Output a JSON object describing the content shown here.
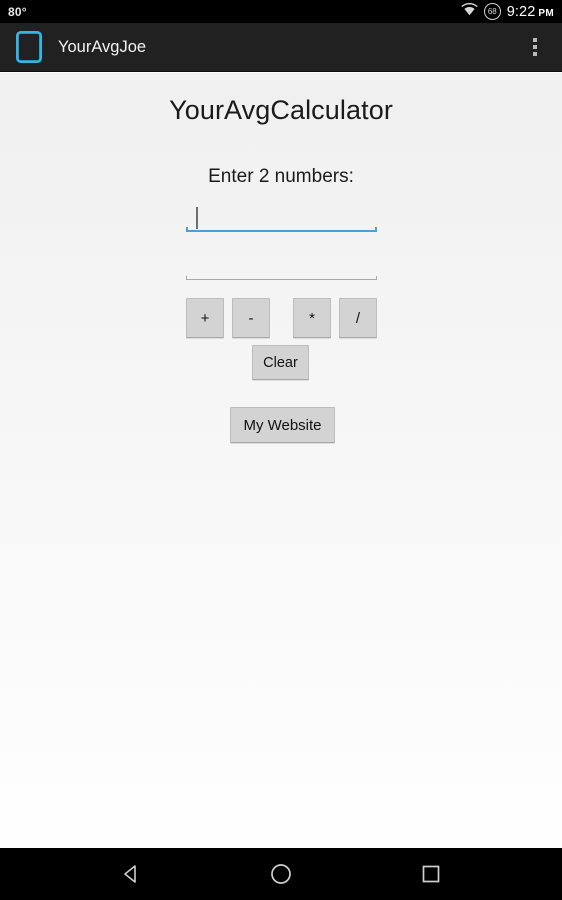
{
  "status_bar": {
    "temperature": "80°",
    "wifi_icon": "wifi-icon",
    "battery_level": "68",
    "time": "9:22",
    "meridiem": "PM"
  },
  "action_bar": {
    "app_icon": "phone-app-icon",
    "app_name": "YourAvgJoe",
    "overflow_icon": "overflow-menu-icon"
  },
  "main": {
    "title": "YourAvgCalculator",
    "prompt": "Enter 2 numbers:",
    "inputs": [
      {
        "name": "first-number",
        "value": "",
        "placeholder": "",
        "focused": true
      },
      {
        "name": "second-number",
        "value": "",
        "placeholder": "",
        "focused": false
      }
    ],
    "operator_buttons": [
      {
        "label": "+",
        "name": "add-button"
      },
      {
        "label": "-",
        "name": "subtract-button"
      },
      {
        "label": "*",
        "name": "multiply-button"
      },
      {
        "label": "/",
        "name": "divide-button"
      }
    ],
    "clear_button": "Clear",
    "website_button": "My Website"
  },
  "nav_bar": {
    "back": "back-nav-button",
    "home": "home-nav-button",
    "recents": "recents-nav-button"
  },
  "colors": {
    "status_bar_bg": "#000000",
    "action_bar_bg": "#212121",
    "focus_underline": "#4a9fd5",
    "idle_underline": "#a9a9a9",
    "button_face": "#d3d3d3",
    "app_icon": "#33b5e5"
  }
}
